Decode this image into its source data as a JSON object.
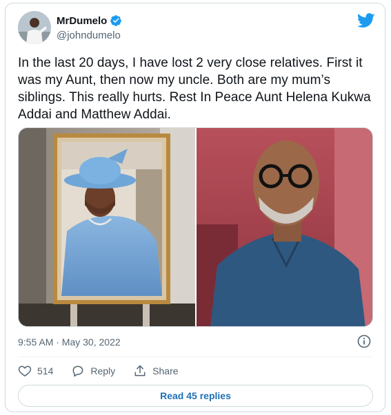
{
  "author": {
    "display_name": "MrDumelo",
    "handle": "@johndumelo",
    "verified": true
  },
  "tweet": {
    "text": "In the last 20 days, I have lost 2 very close relatives. First it was my Aunt, then now my uncle. Both are my mum’s siblings. This really hurts. Rest In Peace Aunt Helena Kukwa Addai and Matthew Addai.",
    "timestamp": "9:55 AM · May 30, 2022"
  },
  "media": {
    "left_image": "framed-portrait-woman-blue-hat",
    "right_image": "portrait-man-glasses-blue-shirt"
  },
  "actions": {
    "like_count": "514",
    "reply_label": "Reply",
    "share_label": "Share"
  },
  "read_replies_label": "Read 45 replies",
  "colors": {
    "brand_blue": "#1d9bf0",
    "link_blue": "#1d70b8",
    "text_primary": "#0f1419",
    "text_secondary": "#536471",
    "border": "#cfd9de"
  },
  "icons": [
    "verified-badge-icon",
    "twitter-bird-icon",
    "info-icon",
    "heart-icon",
    "reply-bubble-icon",
    "share-icon"
  ]
}
